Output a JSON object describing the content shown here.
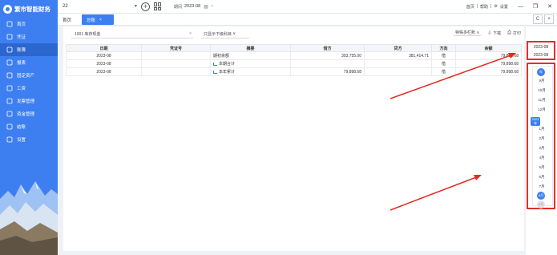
{
  "app": {
    "logo_text": "繁市智能财务",
    "company": "22",
    "period_label": "期间",
    "period_value": "2023-08",
    "top_links": [
      "首页",
      "帮助",
      "设置"
    ]
  },
  "sidebar": {
    "items": [
      {
        "label": "首页",
        "icon": "home-icon"
      },
      {
        "label": "凭证",
        "icon": "voucher-icon"
      },
      {
        "label": "账簿",
        "icon": "ledger-icon"
      },
      {
        "label": "报表",
        "icon": "report-icon"
      },
      {
        "label": "固定资产",
        "icon": "asset-icon"
      },
      {
        "label": "工资",
        "icon": "salary-icon"
      },
      {
        "label": "发票管理",
        "icon": "invoice-icon"
      },
      {
        "label": "资金管理",
        "icon": "fund-icon"
      },
      {
        "label": "结账",
        "icon": "close-book-icon"
      },
      {
        "label": "设置",
        "icon": "settings-icon"
      }
    ],
    "active_index": 2
  },
  "tabs": {
    "home": "首页",
    "current": "总账"
  },
  "filters": {
    "account": "1001 库存现金",
    "sub_account": "只显示下级科目",
    "style": "特殊多栏账",
    "download": "下载",
    "print": "打印"
  },
  "table": {
    "headers": [
      "日期",
      "凭证号",
      "摘要",
      "借方",
      "贷方",
      "方向",
      "余额"
    ],
    "rows": [
      {
        "date": "2023-08",
        "voucher": "",
        "summary": "期初余额",
        "debit": "303,755.00",
        "credit": "381,414.71",
        "dir": "借",
        "balance": "79,898.68",
        "icon": false
      },
      {
        "date": "2023-08",
        "voucher": "",
        "summary": "本期合计",
        "debit": "",
        "credit": "",
        "dir": "借",
        "balance": "79,898.68",
        "icon": true
      },
      {
        "date": "2023-08",
        "voucher": "",
        "summary": "本年累计",
        "debit": "79,898.68",
        "credit": "",
        "dir": "借",
        "balance": "79,898.68",
        "icon": true
      }
    ]
  },
  "period_panel": {
    "start": "2023-08",
    "end": "2023-08",
    "top_year_btn": "年",
    "months": [
      "9月",
      "10月",
      "11月",
      "12月",
      "2023年",
      "1月",
      "2月",
      "3月",
      "4月",
      "5月",
      "6月",
      "7月"
    ],
    "selected_btn": "8月",
    "bottom_btn": "9月"
  }
}
